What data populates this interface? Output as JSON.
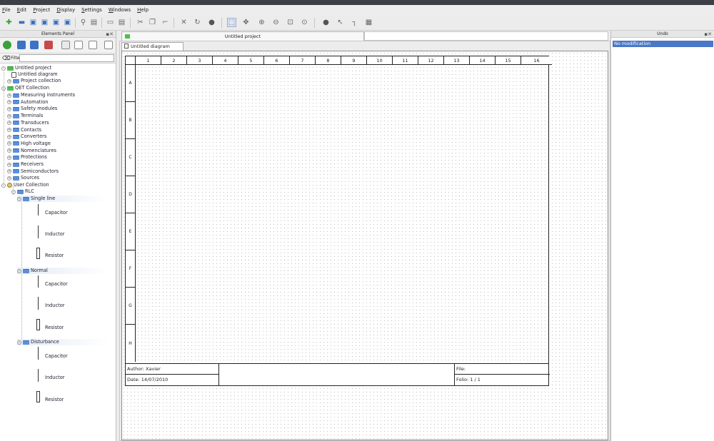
{
  "menu": [
    "File",
    "Edit",
    "Project",
    "Display",
    "Settings",
    "Windows",
    "Help"
  ],
  "elements_panel": {
    "title": "Elements Panel",
    "filter_label": "Filter:",
    "filter_value": "",
    "tree": {
      "project": "Untitled project",
      "diagram": "Untitled diagram",
      "project_collection": "Project collection",
      "qet_collection": "QET Collection",
      "qet_children": [
        "Measuring instruments",
        "Automation",
        "Safety modules",
        "Terminals",
        "Transducers",
        "Contacts",
        "Converters",
        "High voltage",
        "Nomenclatures",
        "Protections",
        "Receivers",
        "Semiconductors",
        "Sources"
      ],
      "user_collection": "User Collection",
      "rlc": "RLC",
      "groups": [
        {
          "name": "Single line",
          "items": [
            "Capacitor",
            "Inductor",
            "Resistor"
          ]
        },
        {
          "name": "Normal",
          "items": [
            "Capacitor",
            "Inductor",
            "Resistor"
          ]
        },
        {
          "name": "Disturbance",
          "items": [
            "Capacitor",
            "Inductor",
            "Resistor"
          ]
        }
      ]
    }
  },
  "project_tab": "Untitled project",
  "diagram_tab": "Untitled diagram",
  "columns": [
    "1",
    "2",
    "3",
    "4",
    "5",
    "6",
    "7",
    "8",
    "9",
    "10",
    "11",
    "12",
    "13",
    "14",
    "15",
    "16"
  ],
  "rows": [
    "A",
    "B",
    "C",
    "D",
    "E",
    "F",
    "G",
    "H"
  ],
  "title_block": {
    "author": "Author: Xavier",
    "date": "Date: 14/07/2010",
    "title": "",
    "file": "File:",
    "folio": "Folio: 1 / 1"
  },
  "undo_panel": {
    "title": "Undo",
    "items": [
      "No modification"
    ]
  }
}
